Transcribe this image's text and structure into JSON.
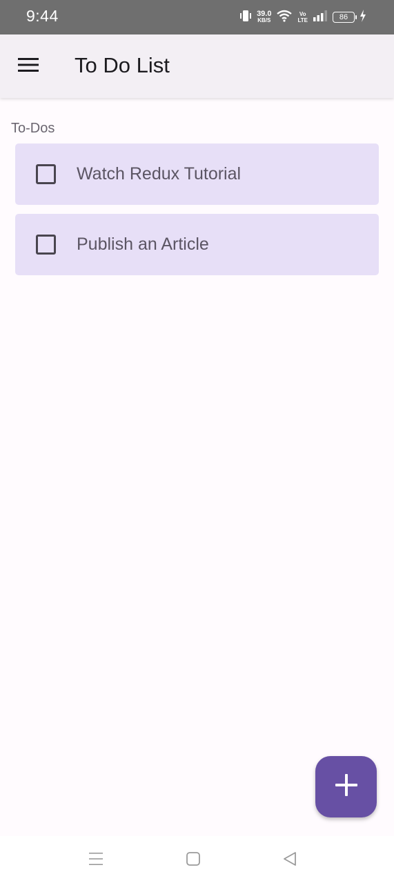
{
  "status_bar": {
    "time": "9:44",
    "net_speed_value": "39.0",
    "net_speed_unit": "KB/S",
    "volte_top": "Vo",
    "volte_bottom": "LTE",
    "battery": "86"
  },
  "app_bar": {
    "title": "To Do List"
  },
  "main": {
    "section_label": "To-Dos",
    "todos": [
      {
        "text": "Watch Redux Tutorial",
        "checked": false
      },
      {
        "text": "Publish an Article",
        "checked": false
      }
    ]
  },
  "colors": {
    "accent": "#6750a4",
    "card": "#e7dff7",
    "app_bar": "#f3eff4"
  },
  "icons": {
    "menu": "menu-icon",
    "add": "plus-icon",
    "nav_recents": "recents-icon",
    "nav_home": "home-icon",
    "nav_back": "back-icon"
  }
}
